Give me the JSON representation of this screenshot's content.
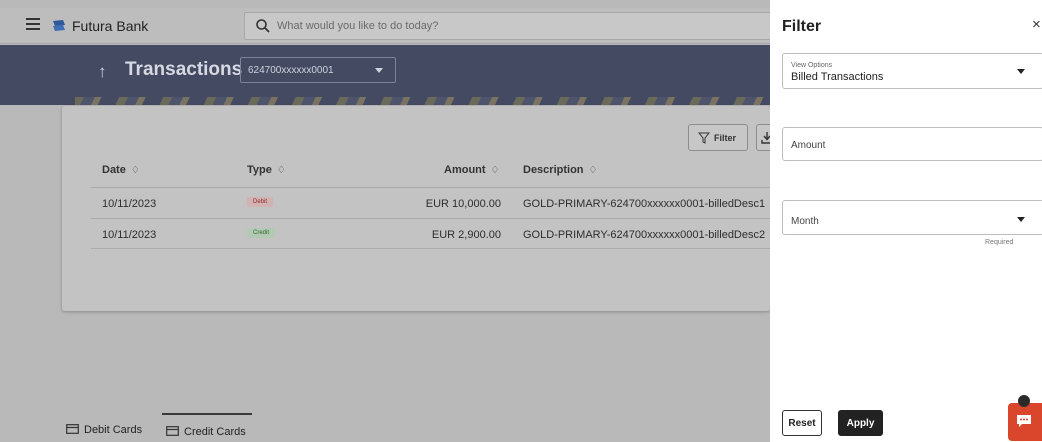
{
  "header": {
    "brand": "Futura Bank",
    "search_placeholder": "What would you like to do today?",
    "icons": {
      "menu": "hamburger-icon",
      "logo": "futura-bank-logo-icon",
      "search": "search-icon"
    }
  },
  "page": {
    "title": "Transactions",
    "account": "624700xxxxxx0001",
    "back_icon": "arrow-up-icon"
  },
  "toolbar": {
    "filter_label": "Filter",
    "filter_icon": "funnel-icon",
    "download_icon": "download-icon"
  },
  "table": {
    "columns": [
      "Date",
      "Type",
      "Amount",
      "Description"
    ],
    "sort_glyph": "♢",
    "rows": [
      {
        "date": "10/11/2023",
        "type": "Debit",
        "amount": "EUR 10,000.00",
        "description": "GOLD-PRIMARY-624700xxxxxx0001-billedDesc1"
      },
      {
        "date": "10/11/2023",
        "type": "Credit",
        "amount": "EUR 2,900.00",
        "description": "GOLD-PRIMARY-624700xxxxxx0001-billedDesc2"
      }
    ]
  },
  "bottom_tabs": [
    {
      "label": "Debit Cards",
      "icon": "card-icon",
      "active": false
    },
    {
      "label": "Credit Cards",
      "icon": "card-icon",
      "active": true
    }
  ],
  "filter_panel": {
    "title": "Filter",
    "close_glyph": "×",
    "view_options": {
      "label": "View Options",
      "value": "Billed Transactions"
    },
    "amount": {
      "placeholder": "Amount"
    },
    "month": {
      "placeholder": "Month",
      "hint": "Required"
    },
    "reset_label": "Reset",
    "apply_label": "Apply"
  },
  "colors": {
    "hero": "#434a62",
    "apply": "#222222",
    "chat": "#d9462b",
    "debit_badge": "#8a2a2a",
    "credit_badge": "#2b6b2b"
  },
  "chat_icon": "chat-bubble-icon"
}
